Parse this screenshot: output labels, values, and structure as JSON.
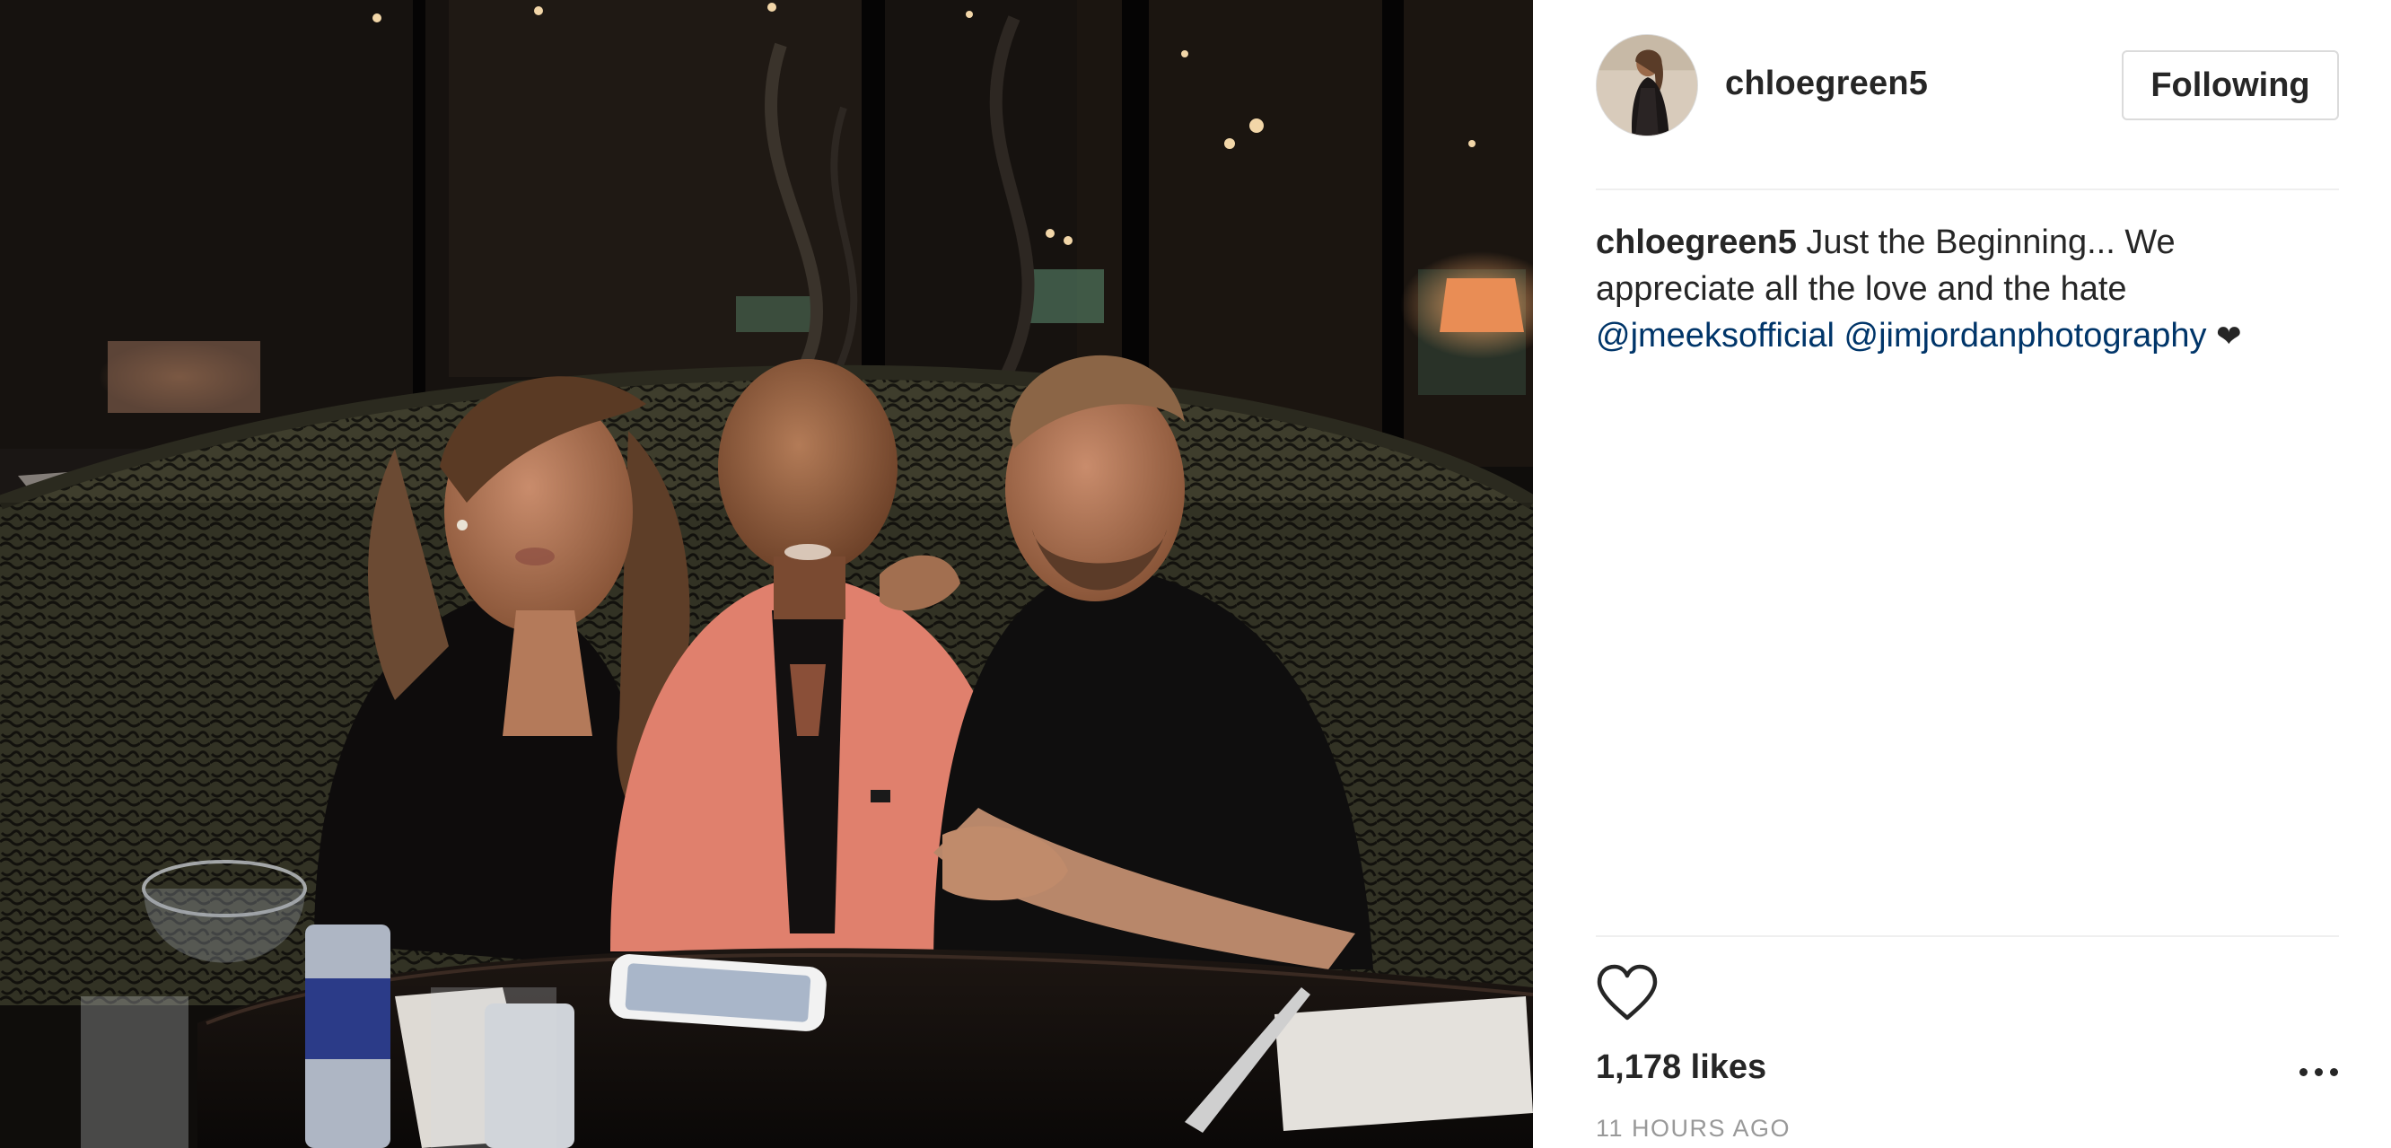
{
  "post": {
    "photo_alt": "Three people seated at a restaurant booth table",
    "icon": "post-photo"
  },
  "header": {
    "username": "chloegreen5",
    "follow_label": "Following",
    "avatar_icon": "profile-avatar"
  },
  "caption": {
    "username": "chloegreen5",
    "text": " Just the Beginning... We appreciate all the love and the hate ",
    "mention1": "@jmeeksofficial",
    "mention2": "@jimjordanphotography",
    "emoji": "❤"
  },
  "actions": {
    "like_icon": "heart-outline-icon",
    "more_icon": "more-options-icon"
  },
  "likes": "1,178 likes",
  "timestamp": "11 HOURS AGO",
  "colors": {
    "text": "#262626",
    "link": "#003569",
    "muted": "#999999",
    "border": "#dbdbdb"
  }
}
